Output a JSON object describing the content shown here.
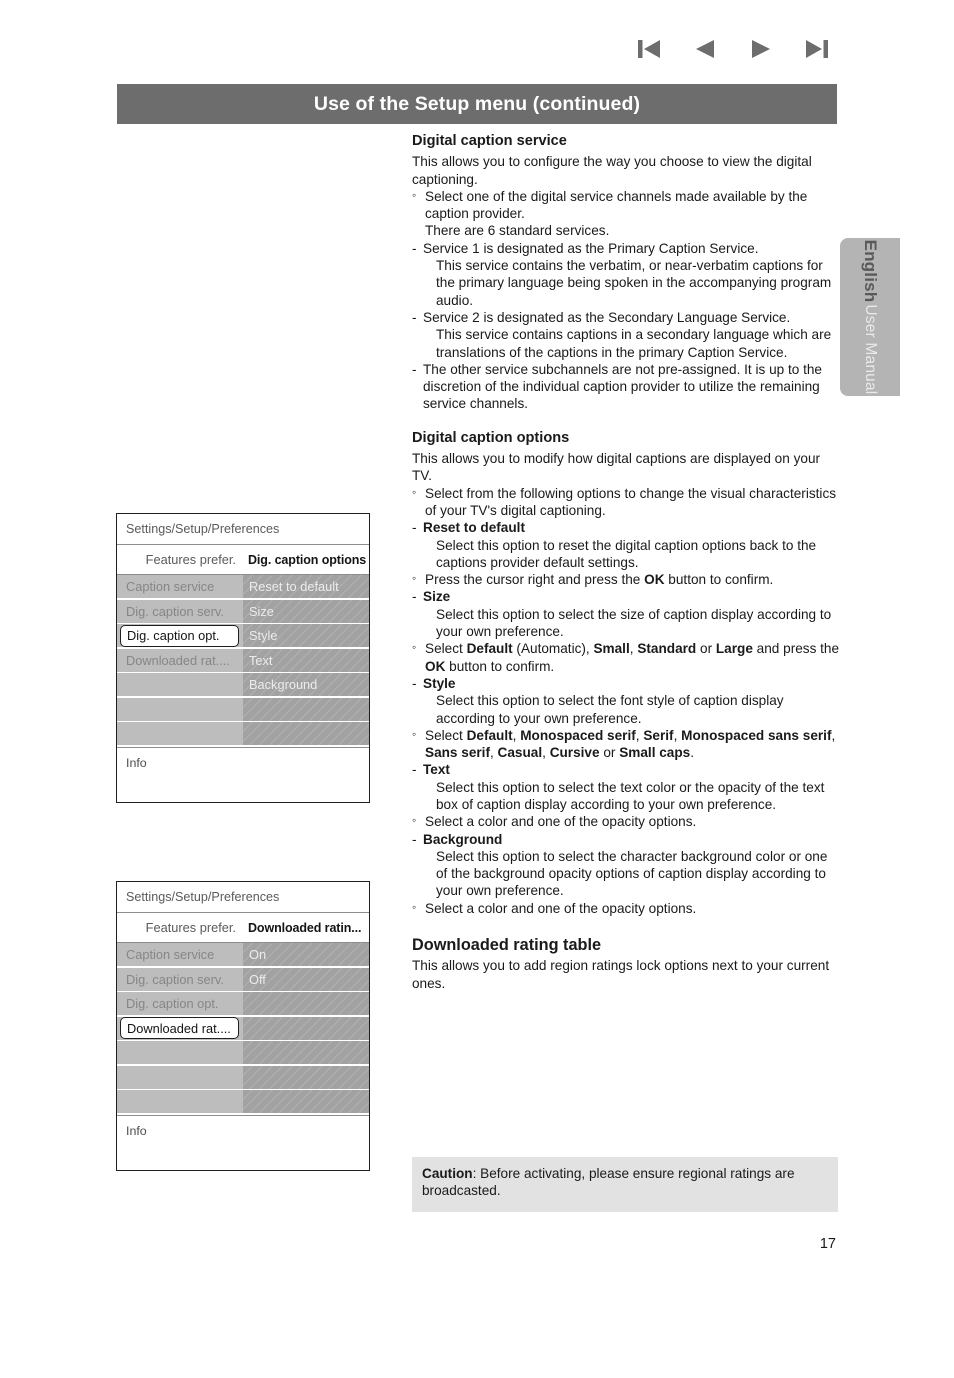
{
  "nav": {
    "first_label": "first-page",
    "prev_label": "previous-page",
    "next_label": "next-page",
    "last_label": "last-page"
  },
  "header": {
    "title": "Use of the Setup menu  (continued)",
    "bar_color": "#6d6d6d"
  },
  "side_tab": {
    "language": "English",
    "manual": "User Manual",
    "color": "#b4b4b4"
  },
  "page_number": "17",
  "sections": {
    "digital_caption_service": {
      "heading": "Digital caption service",
      "intro": "This allows you to configure the way you choose to view the digital captioning.",
      "bullet1": "Select one of the digital service channels made available by the caption provider.",
      "standard_services": "There are 6 standard services.",
      "service1_title": "Service 1 is designated as the Primary Caption Service.",
      "service1_body": "This service contains the verbatim, or near-verbatim captions for the primary language being spoken in the accompanying program audio.",
      "service2_title": "Service 2 is designated as the Secondary Language Service.",
      "service2_body": "This service contains captions in a secondary language which are translations of the captions in the primary Caption Service.",
      "other_services": "The other service subchannels are not pre-assigned. It is up to the discretion of the individual caption provider to utilize the remaining service channels."
    },
    "digital_caption_options": {
      "heading": "Digital caption options",
      "intro": "This allows you to modify how digital captions are displayed on your TV.",
      "bullet1": "Select from the following options to change the visual characteristics of your TV's digital captioning.",
      "items": [
        {
          "title": "Reset to default",
          "body": "Select this option to reset the digital caption options back to the captions provider default settings.",
          "note_pre": "Press the cursor right and press the ",
          "note_bold": "OK",
          "note_post": " button to confirm."
        },
        {
          "title": "Size",
          "body": "Select this option to select the size of caption display according to your own preference."
        },
        {
          "title": "Style",
          "body": "Select this option to select the font style of caption display according to your own preference."
        },
        {
          "title": "Text",
          "body": "Select this option to select the text color or the opacity of the text box of caption display according to your own preference.",
          "note": "Select a color and one of the opacity options."
        },
        {
          "title": "Background",
          "body": "Select this option to select the character background color or one of the background opacity options of caption display according to your own preference.",
          "note": "Select a color and one of the opacity options."
        }
      ],
      "size_note": {
        "lead": "Select ",
        "o1": "Default",
        "paren": " (Automatic), ",
        "o2": "Small",
        "sep1": ", ",
        "o3": "Standard",
        "sep2": " or ",
        "o4": "Large",
        "tail_pre": " and press the ",
        "tail_bold": "OK",
        "tail_post": " button to confirm."
      },
      "style_note": {
        "lead": "Select ",
        "o1": "Default",
        "o2": "Monospaced serif",
        "o3": "Serif",
        "o4": "Monospaced sans serif",
        "o5": "Sans serif",
        "o6": "Casual",
        "o7": "Cursive",
        "o8": "Small caps"
      }
    },
    "downloaded_rating_table": {
      "heading": "Downloaded rating table",
      "body": "This allows you to add region ratings lock options next to your current ones."
    },
    "caution": {
      "label": "Caution",
      "text": ": Before activating, please ensure regional ratings are broadcasted.",
      "bg_color": "#e2e2e2"
    }
  },
  "tv_menus": [
    {
      "path": "Settings/Setup/Preferences",
      "left_header": "Features prefer.",
      "right_header": "Dig. caption options",
      "info_label": "Info",
      "rows": [
        {
          "left": "Caption service",
          "right": "Reset to default",
          "selected": false
        },
        {
          "left": "Dig. caption serv.",
          "right": "Size",
          "selected": false
        },
        {
          "left": "Dig. caption opt.",
          "right": "Style",
          "selected": true
        },
        {
          "left": "Downloaded rat....",
          "right": "Text",
          "selected": false
        },
        {
          "left": "",
          "right": "Background",
          "selected": false
        },
        {
          "left": "",
          "right": "",
          "selected": false
        },
        {
          "left": "",
          "right": "",
          "selected": false
        }
      ]
    },
    {
      "path": "Settings/Setup/Preferences",
      "left_header": "Features prefer.",
      "right_header": "Downloaded ratin...",
      "info_label": "Info",
      "rows": [
        {
          "left": "Caption service",
          "right": "On",
          "selected": false
        },
        {
          "left": "Dig. caption serv.",
          "right": "Off",
          "selected": false
        },
        {
          "left": "Dig. caption opt.",
          "right": "",
          "selected": false
        },
        {
          "left": "Downloaded rat....",
          "right": "",
          "selected": true
        },
        {
          "left": "",
          "right": "",
          "selected": false
        },
        {
          "left": "",
          "right": "",
          "selected": false
        },
        {
          "left": "",
          "right": "",
          "selected": false
        }
      ]
    }
  ]
}
